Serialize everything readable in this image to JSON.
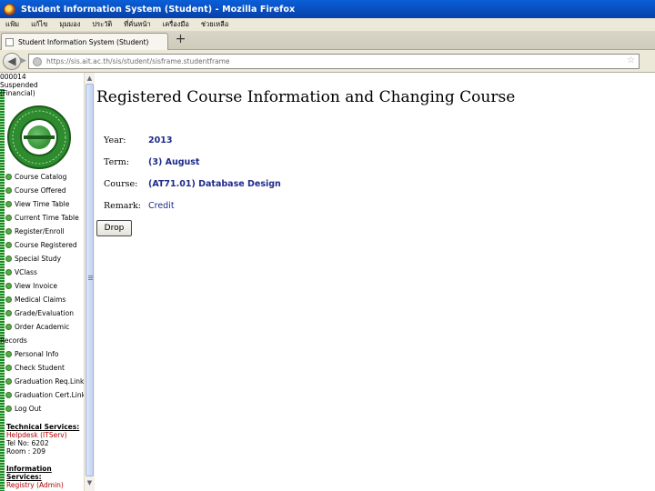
{
  "window": {
    "title": "Student Information System (Student) - Mozilla Firefox"
  },
  "menubar": {
    "items": [
      "แฟ้ม",
      "แก้ไข",
      "มุมมอง",
      "ประวัติ",
      "ที่คั่นหน้า",
      "เครื่องมือ",
      "ช่วยเหลือ"
    ]
  },
  "tabs": [
    {
      "label": "Student Information System (Student)"
    }
  ],
  "navbar": {
    "url": "https://sis.ait.ac.th/sis/student/sisframe.studentframe"
  },
  "left_frame": {
    "status_lines": [
      "000014",
      "Suspended",
      "(Financial)"
    ],
    "menu": [
      {
        "label": "Course Catalog"
      },
      {
        "label": "Course Offered"
      },
      {
        "label": "View Time Table"
      },
      {
        "label": "Current Time Table"
      },
      {
        "label": "Register/Enroll"
      },
      {
        "label": "Course Registered"
      },
      {
        "label": "Special Study"
      },
      {
        "label": "VClass"
      },
      {
        "label": "View Invoice"
      },
      {
        "label": "Medical Claims"
      },
      {
        "label": "Grade/Evaluation"
      },
      {
        "label": "Order Academic",
        "continuation": "Records"
      },
      {
        "label": "Personal Info"
      },
      {
        "label": "Check Student"
      },
      {
        "label": "Graduation Req.Link"
      },
      {
        "label": "Graduation Cert.Link"
      },
      {
        "label": "Log Out"
      }
    ],
    "technical_services": {
      "title": "Technical Services:",
      "link": "Helpdesk (ITServ)",
      "lines": [
        "Tel No: 6202",
        "Room : 209"
      ]
    },
    "information_services": {
      "title": "Information",
      "title2": "Services:",
      "link": "Registry (Admin)"
    }
  },
  "main": {
    "heading": "Registered Course Information and Changing Course",
    "rows": [
      {
        "label": "Year:",
        "value": "2013"
      },
      {
        "label": "Term:",
        "value": "(3) August"
      },
      {
        "label": "Course:",
        "value": "(AT71.01) Database Design"
      },
      {
        "label": "Remark:",
        "value": "Credit"
      }
    ],
    "drop_label": "Drop"
  }
}
